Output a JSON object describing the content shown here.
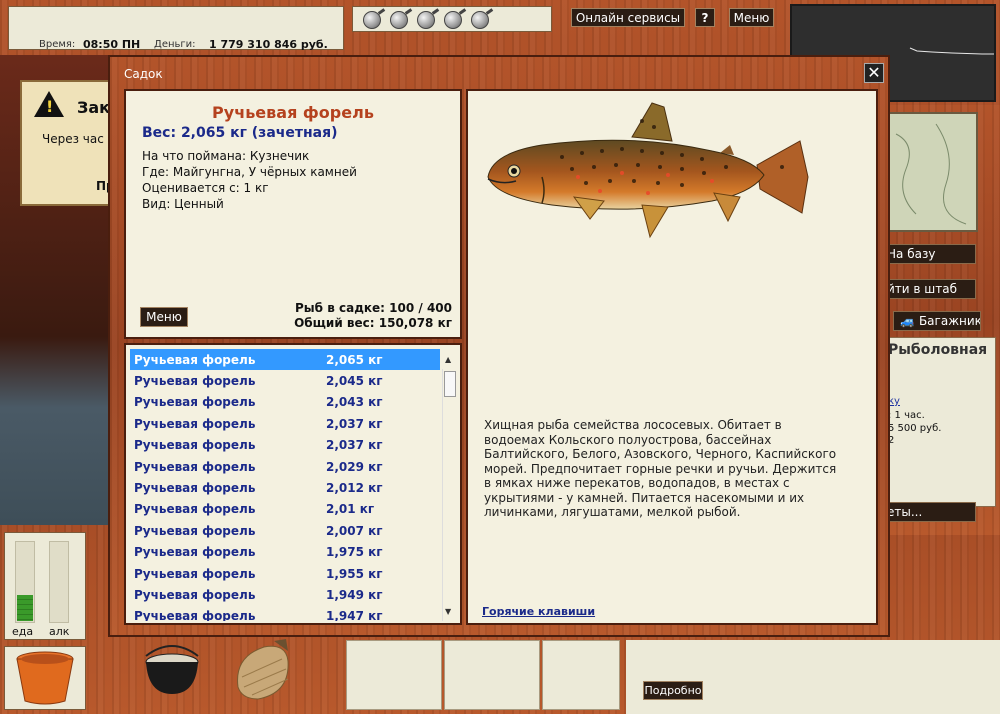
{
  "status": {
    "time_label": "Время:",
    "time_value": "08:50 ПН",
    "money_label": "Деньги:",
    "money_value": "1 779 310 846 руб."
  },
  "topbar": {
    "online_services": "Онлайн сервисы",
    "help": "?",
    "menu": "Меню"
  },
  "notice": {
    "title": "Зак",
    "line": "Через час",
    "line2": "Пр"
  },
  "right_buttons": {
    "to_base": "На базу",
    "to_hq": "йти в штаб",
    "trunk": "Багажник",
    "shop_title": "Рыболовная",
    "shop_link": "ку",
    "shop_time": ": 1 час.",
    "shop_price": "5 500 руб.",
    "shop_num": "2",
    "tickets": "еты..."
  },
  "meters": {
    "food_label": "еда",
    "alc_label": "алк",
    "food_level": 0.33,
    "alc_level": 0.0
  },
  "bottom": {
    "details": "Подробно"
  },
  "dialog": {
    "title": "Садок",
    "close": "✕",
    "fish_name": "Ручьевая форель",
    "weight_line": "Вес: 2,065 кг (зачетная)",
    "caught_with": "На что поймана: Кузнечик",
    "where": "Где: Майгунгна, У чёрных камней",
    "rated_from": "Оценивается с: 1 кг",
    "kind": "Вид: Ценный",
    "menu": "Меню",
    "count_line": "Рыб в садке: 100 / 400",
    "total_weight": "Общий вес: 150,078 кг",
    "description": "Хищная рыба семейства лососевых. Обитает в водоемах Кольского полуострова, бассейнах Балтийского, Белого, Азовского, Черного, Каспийского морей. Предпочитает горные речки и ручьи. Держится в ямках ниже перекатов, водопадов, в местах с укрытиями - у камней. Питается насекомыми и их личинками, лягушатами, мелкой рыбой.",
    "hotkeys": "Горячие клавиши",
    "fish_list": [
      {
        "name": "Ручьевая форель",
        "weight": "2,065 кг"
      },
      {
        "name": "Ручьевая форель",
        "weight": "2,045 кг"
      },
      {
        "name": "Ручьевая форель",
        "weight": "2,043 кг"
      },
      {
        "name": "Ручьевая форель",
        "weight": "2,037 кг"
      },
      {
        "name": "Ручьевая форель",
        "weight": "2,037 кг"
      },
      {
        "name": "Ручьевая форель",
        "weight": "2,029 кг"
      },
      {
        "name": "Ручьевая форель",
        "weight": "2,012 кг"
      },
      {
        "name": "Ручьевая форель",
        "weight": "2,01 кг"
      },
      {
        "name": "Ручьевая форель",
        "weight": "2,007 кг"
      },
      {
        "name": "Ручьевая форель",
        "weight": "1,975 кг"
      },
      {
        "name": "Ручьевая форель",
        "weight": "1,955 кг"
      },
      {
        "name": "Ручьевая форель",
        "weight": "1,949 кг"
      },
      {
        "name": "Ручьевая форель",
        "weight": "1,947 кг"
      }
    ]
  }
}
